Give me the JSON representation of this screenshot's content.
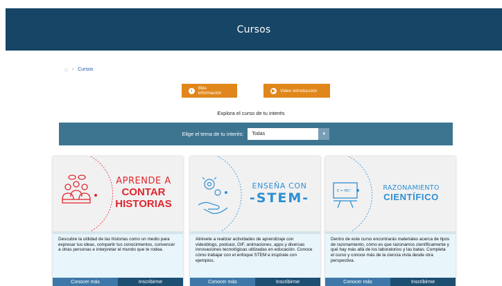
{
  "header": {
    "title": "Cursos"
  },
  "breadcrumb": {
    "home_icon": "home-icon",
    "current": "Cursos"
  },
  "buttons": {
    "more_info": "Más información",
    "intro_video": "Video introducción"
  },
  "explore_text": "Explora el curso de tu interés",
  "filter": {
    "label": "Elige el tema de tu interés:",
    "selected": "Todas"
  },
  "colors": {
    "header": "#174565",
    "accent": "#e0861a",
    "filter_bar": "#3d7591",
    "red": "#e0262f",
    "blue": "#2d8fd4"
  },
  "cards": [
    {
      "title_top": "APRENDE A",
      "title_mid": "CONTAR",
      "title_bot": "HISTORIAS",
      "description": "Descubre la utilidad de las historias como un medio para expresar tus ideas, compartir tus conocimientos, convencer a otras personas e interpretar el mundo que te rodea.",
      "primary": "Conocer más",
      "secondary": "Inscribirme"
    },
    {
      "title_top": "ENSEÑA CON",
      "title_bot": "-STEM-",
      "description": "Atrévete a realizar actividades de aprendizaje con videoblogs, podcast, GIF, animaciones, apps y diversas innovaciones tecnológicas utilizadas en educación. Conoce cómo trabajar con el enfoque STEM e inspírate con ejemplos.",
      "primary": "Conocer más",
      "secondary": "Inscribirme"
    },
    {
      "title_top": "RAZONAMIENTO",
      "title_bot": "CIENTÍFICO",
      "board_text": "E = MC²",
      "description": "Dentro de este curso encontrarás materiales acerca de tipos de razonamiento, cómo es que razonamos científicamente y qué hay más allá de los laboratorios y las batas. Completa el curso y conoce más de la ciencia vista desde otra perspectiva.",
      "primary": "Conocer más",
      "secondary": "Inscribirme"
    }
  ]
}
